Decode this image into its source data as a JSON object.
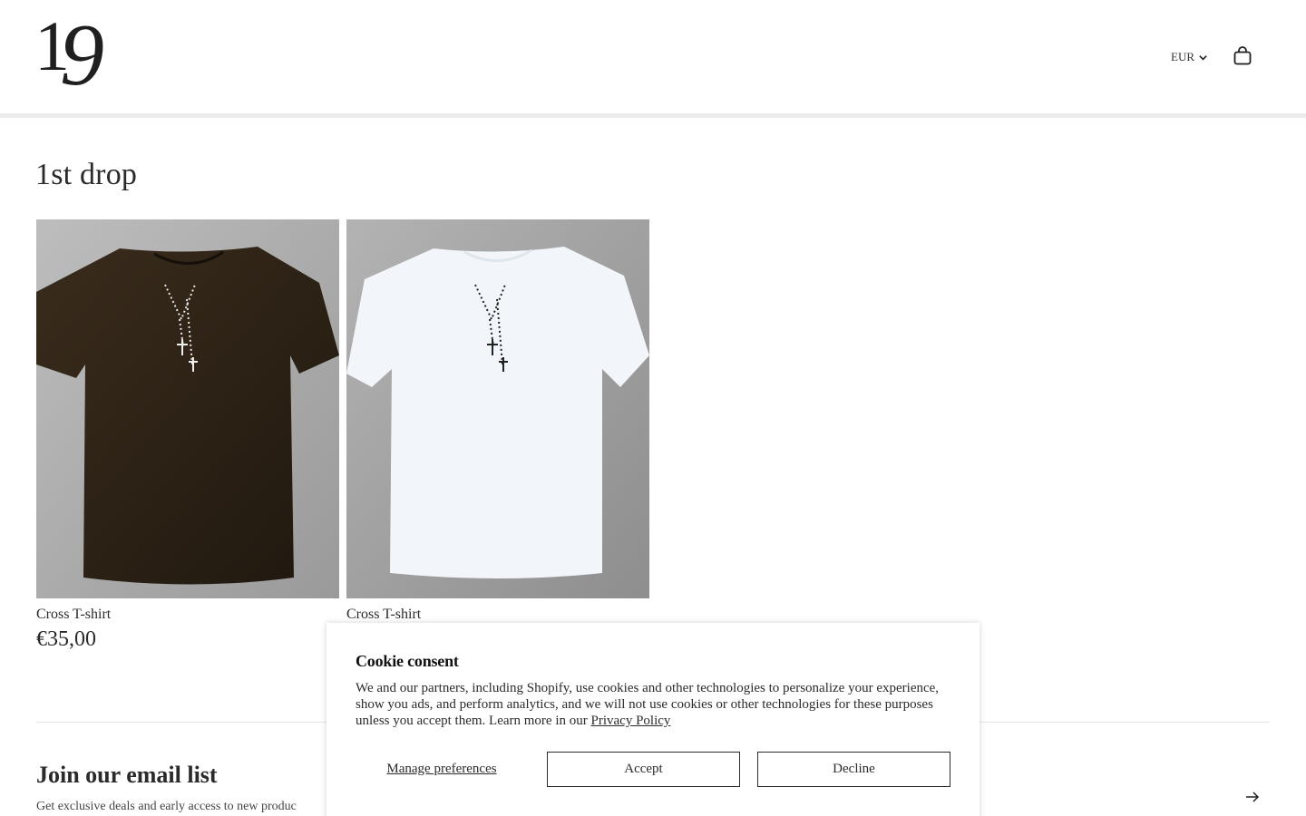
{
  "header": {
    "logo_text_1": "1",
    "logo_text_2": "9",
    "currency": "EUR",
    "icons": {
      "currency_chevron": "chevron-down-icon",
      "cart": "shopping-bag-icon"
    }
  },
  "collection": {
    "title": "1st drop",
    "products": [
      {
        "name": "Cross T-shirt",
        "price": "€35,00",
        "shirt_color": "#2f2417"
      },
      {
        "name": "Cross T-shirt",
        "price": "",
        "shirt_color": "#f4f8fc"
      }
    ]
  },
  "newsletter": {
    "title": "Join our email list",
    "subtitle": "Get exclusive deals and early access to new produc",
    "submit_icon": "arrow-right-icon"
  },
  "cookie": {
    "title": "Cookie consent",
    "text": "We and our partners, including Shopify, use cookies and other technologies to personalize your experience, show you ads, and perform analytics, and we will not use cookies or other technologies for these purposes unless you accept them. Learn more in our ",
    "link": "Privacy Policy",
    "manage": "Manage preferences",
    "accept": "Accept",
    "decline": "Decline"
  }
}
